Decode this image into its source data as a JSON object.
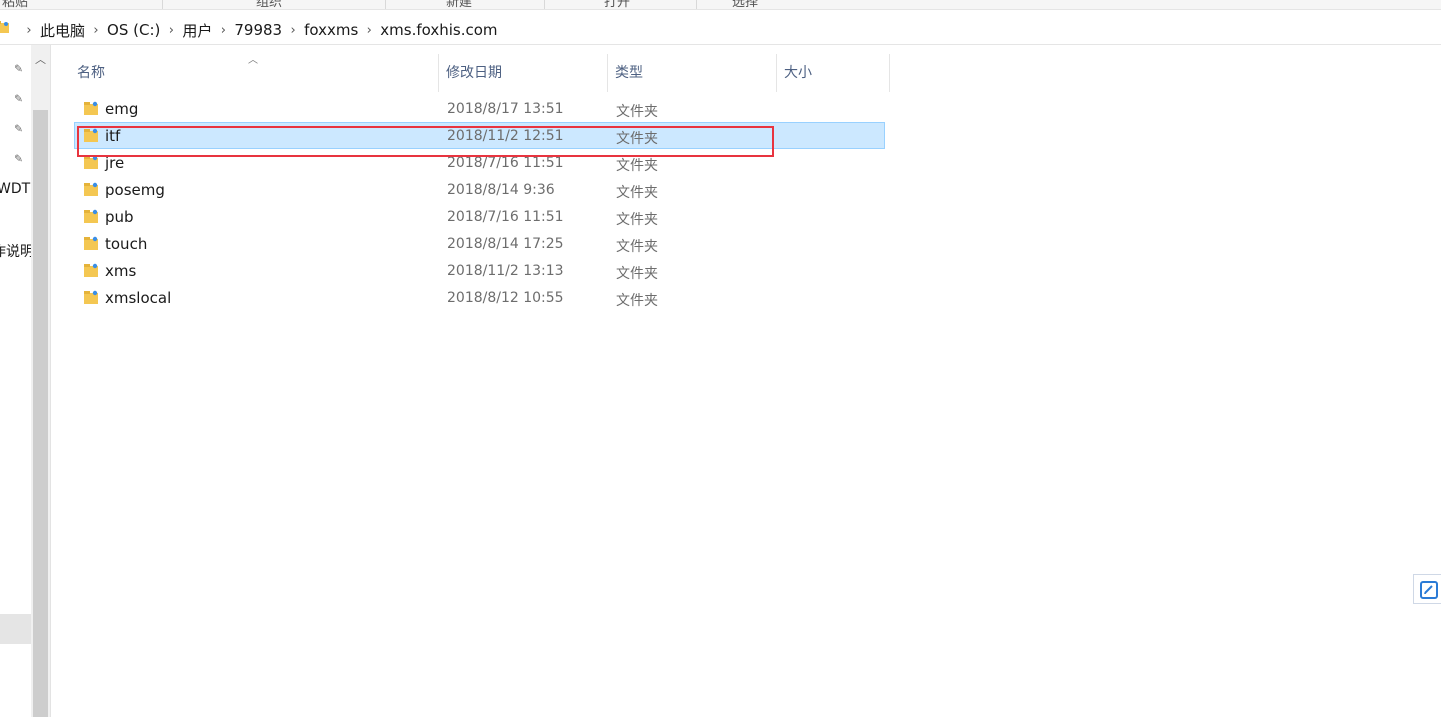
{
  "ribbon": {
    "groups": [
      "粘贴",
      "组织",
      "新建",
      "打开",
      "选择"
    ]
  },
  "addressbar": {
    "crumbs": [
      "此电脑",
      "OS (C:)",
      "用户",
      "79983",
      "foxxms",
      "xms.foxhis.com"
    ]
  },
  "navpane": {
    "labels": [
      "WDT",
      "作说明"
    ]
  },
  "columns": {
    "name": "名称",
    "modified": "修改日期",
    "type": "类型",
    "size": "大小"
  },
  "files": [
    {
      "name": "emg",
      "modified": "2018/8/17 13:51",
      "type": "文件夹",
      "selected": false
    },
    {
      "name": "itf",
      "modified": "2018/11/2 12:51",
      "type": "文件夹",
      "selected": true
    },
    {
      "name": "jre",
      "modified": "2018/7/16 11:51",
      "type": "文件夹",
      "selected": false
    },
    {
      "name": "posemg",
      "modified": "2018/8/14 9:36",
      "type": "文件夹",
      "selected": false
    },
    {
      "name": "pub",
      "modified": "2018/7/16 11:51",
      "type": "文件夹",
      "selected": false
    },
    {
      "name": "touch",
      "modified": "2018/8/14 17:25",
      "type": "文件夹",
      "selected": false
    },
    {
      "name": "xms",
      "modified": "2018/11/2 13:13",
      "type": "文件夹",
      "selected": false
    },
    {
      "name": "xmslocal",
      "modified": "2018/8/12 10:55",
      "type": "文件夹",
      "selected": false
    }
  ],
  "colors": {
    "selection_bg": "#cce8ff",
    "selection_border": "#99d1ff",
    "annotation_red": "#e8343f",
    "header_text": "#4d6082"
  },
  "icons": {
    "folder": "folder-icon",
    "pin": "pin-icon",
    "chevron": "chevron-right-icon"
  }
}
